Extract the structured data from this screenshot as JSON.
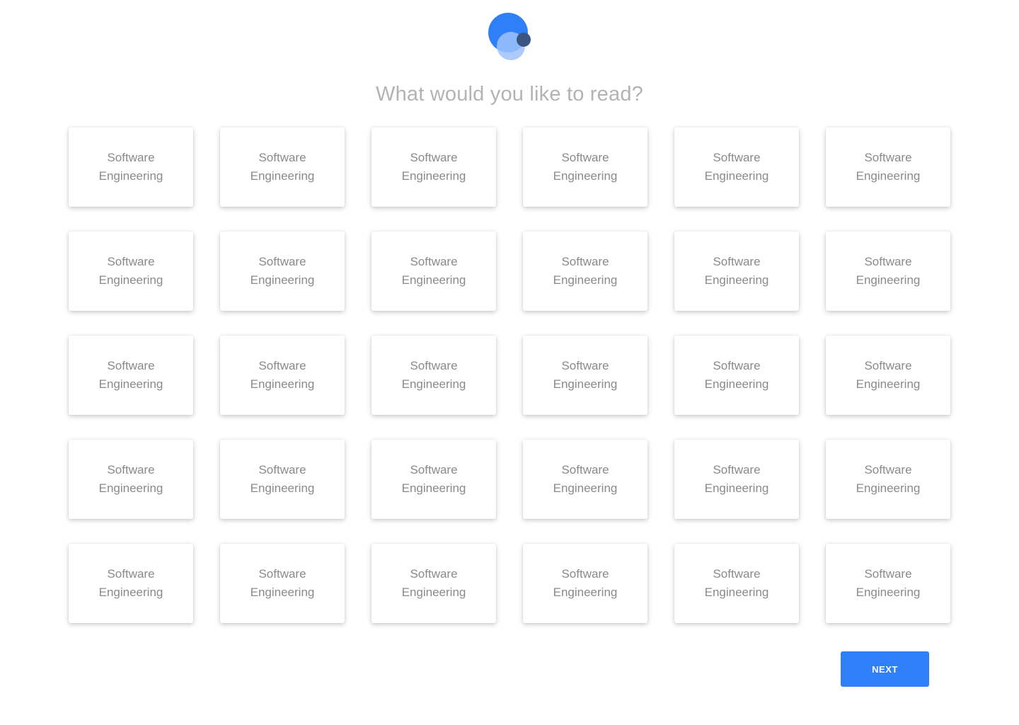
{
  "header": {
    "logo_icon": "brand-bubbles-logo",
    "title": "What would you like to read?"
  },
  "topics": [
    {
      "label": "Software Engineering"
    },
    {
      "label": "Software Engineering"
    },
    {
      "label": "Software Engineering"
    },
    {
      "label": "Software Engineering"
    },
    {
      "label": "Software Engineering"
    },
    {
      "label": "Software Engineering"
    },
    {
      "label": "Software Engineering"
    },
    {
      "label": "Software Engineering"
    },
    {
      "label": "Software Engineering"
    },
    {
      "label": "Software Engineering"
    },
    {
      "label": "Software Engineering"
    },
    {
      "label": "Software Engineering"
    },
    {
      "label": "Software Engineering"
    },
    {
      "label": "Software Engineering"
    },
    {
      "label": "Software Engineering"
    },
    {
      "label": "Software Engineering"
    },
    {
      "label": "Software Engineering"
    },
    {
      "label": "Software Engineering"
    },
    {
      "label": "Software Engineering"
    },
    {
      "label": "Software Engineering"
    },
    {
      "label": "Software Engineering"
    },
    {
      "label": "Software Engineering"
    },
    {
      "label": "Software Engineering"
    },
    {
      "label": "Software Engineering"
    },
    {
      "label": "Software Engineering"
    },
    {
      "label": "Software Engineering"
    },
    {
      "label": "Software Engineering"
    },
    {
      "label": "Software Engineering"
    },
    {
      "label": "Software Engineering"
    },
    {
      "label": "Software Engineering"
    }
  ],
  "footer": {
    "next_label": "NEXT"
  },
  "colors": {
    "accent": "#2f80f8",
    "logo_dark": "#3a5580",
    "logo_light": "#9dc2fb",
    "heading_text": "#b3b3b3",
    "card_text": "#8a8a8a"
  }
}
